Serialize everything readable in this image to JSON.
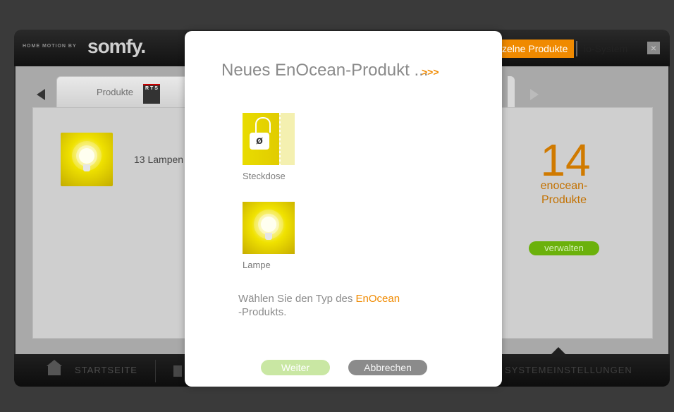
{
  "window": {
    "brand_tagline": "HOME MOTION BY",
    "brand_name": "somfy.",
    "top_tabs": {
      "active_label": "zelne Produkte",
      "other_label": "io-System"
    },
    "close_icon": "×"
  },
  "background_page": {
    "product_tab_label": "Produkte",
    "rts_badge": "R T S",
    "lamp_count_text": "13 Lampen",
    "enocean_count": "14",
    "enocean_label_line1": "enocean-",
    "enocean_label_line2": "Produkte",
    "manage_button": "verwalten",
    "bottom_nav": {
      "home_label": "STARTSEITE",
      "settings_label": "SYSTEMEINSTELLUNGEN"
    }
  },
  "modal": {
    "title": "Neues EnOcean-Produkt ...",
    "more_link": ">>>",
    "options": [
      {
        "label": "Steckdose",
        "icon": "power-plug-icon"
      },
      {
        "label": "Lampe",
        "icon": "lamp-bulb-icon"
      }
    ],
    "instruction_prefix": "Wählen Sie den Typ des ",
    "instruction_highlight": "EnOcean",
    "instruction_suffix": "-Produkts.",
    "next_button": "Weiter",
    "cancel_button": "Abbrechen"
  },
  "colors": {
    "accent_orange": "#f08a00",
    "manage_green": "#6bb10b",
    "next_disabled_green": "#c9e7a3",
    "cancel_gray": "#8b8b8b"
  }
}
